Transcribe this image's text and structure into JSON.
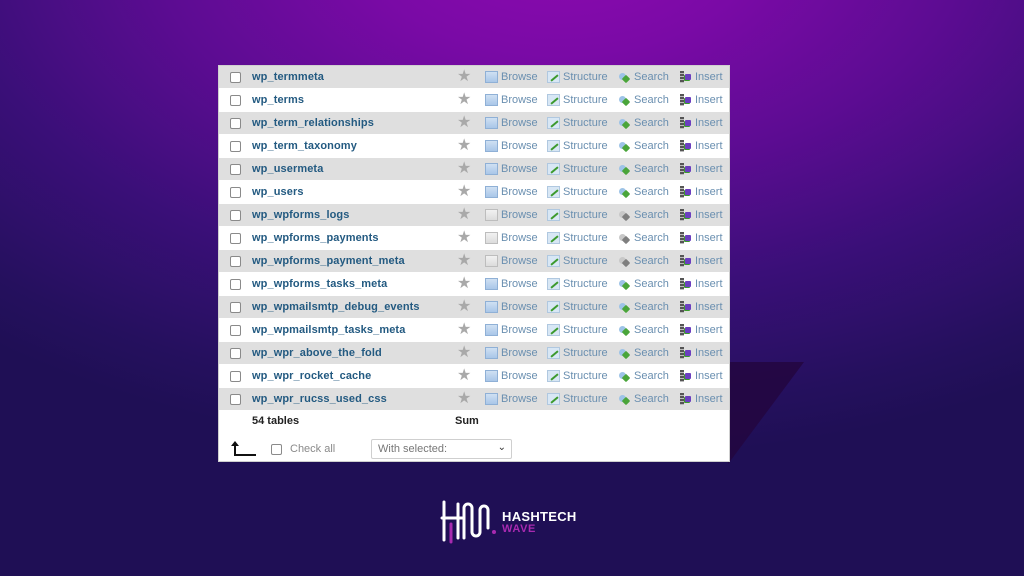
{
  "tables": [
    {
      "name": "wp_termmeta",
      "empty": false
    },
    {
      "name": "wp_terms",
      "empty": false
    },
    {
      "name": "wp_term_relationships",
      "empty": false
    },
    {
      "name": "wp_term_taxonomy",
      "empty": false
    },
    {
      "name": "wp_usermeta",
      "empty": false
    },
    {
      "name": "wp_users",
      "empty": false
    },
    {
      "name": "wp_wpforms_logs",
      "empty": true
    },
    {
      "name": "wp_wpforms_payments",
      "empty": true
    },
    {
      "name": "wp_wpforms_payment_meta",
      "empty": true
    },
    {
      "name": "wp_wpforms_tasks_meta",
      "empty": false
    },
    {
      "name": "wp_wpmailsmtp_debug_events",
      "empty": false
    },
    {
      "name": "wp_wpmailsmtp_tasks_meta",
      "empty": false
    },
    {
      "name": "wp_wpr_above_the_fold",
      "empty": false
    },
    {
      "name": "wp_wpr_rocket_cache",
      "empty": false
    },
    {
      "name": "wp_wpr_rucss_used_css",
      "empty": false
    }
  ],
  "actions": {
    "browse": "Browse",
    "structure": "Structure",
    "search": "Search",
    "insert": "Insert"
  },
  "icons": {
    "favorite": "star-icon",
    "browse": "browse-icon",
    "structure": "structure-icon",
    "search": "search-icon",
    "insert": "insert-icon",
    "check_all_arrow": "arrow-up-left-icon"
  },
  "summary": {
    "count": "54 tables",
    "sum_label": "Sum"
  },
  "footer": {
    "check_all": "Check all",
    "with_selected": "With selected:"
  },
  "logo": {
    "line1": "HASHTECH",
    "line2": "WAVE"
  },
  "colors": {
    "table_link": "#235a81",
    "action_link": "#6a8fb0",
    "row_odd": "#dfdfdf",
    "logo_accent": "#a82ab0"
  }
}
